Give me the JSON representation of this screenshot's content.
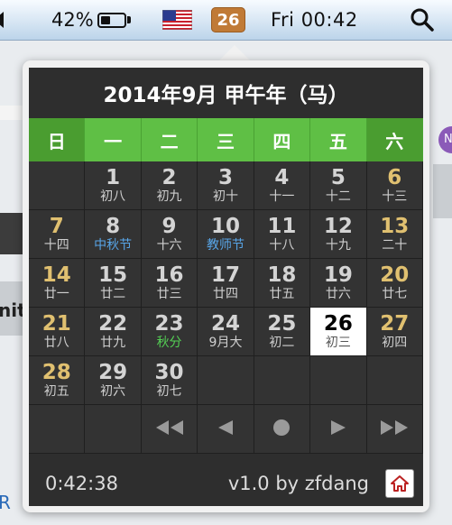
{
  "menubar": {
    "battery_percent": "42%",
    "battery_level": 0.42,
    "date_badge": "26",
    "clock": "Fri 00:42"
  },
  "background": {
    "partial_text": "nit",
    "partial_letter": "R",
    "badge_letter": "N"
  },
  "calendar": {
    "title": "2014年9月 甲午年（马）",
    "weekdays": [
      "日",
      "一",
      "二",
      "三",
      "四",
      "五",
      "六"
    ],
    "days": [
      {
        "d": "",
        "l": ""
      },
      {
        "d": "1",
        "l": "初八"
      },
      {
        "d": "2",
        "l": "初九"
      },
      {
        "d": "3",
        "l": "初十"
      },
      {
        "d": "4",
        "l": "十一"
      },
      {
        "d": "5",
        "l": "十二"
      },
      {
        "d": "6",
        "l": "十三"
      },
      {
        "d": "7",
        "l": "十四"
      },
      {
        "d": "8",
        "l": "中秋节",
        "kind": "fest"
      },
      {
        "d": "9",
        "l": "十六"
      },
      {
        "d": "10",
        "l": "教师节",
        "kind": "fest"
      },
      {
        "d": "11",
        "l": "十八"
      },
      {
        "d": "12",
        "l": "十九"
      },
      {
        "d": "13",
        "l": "二十"
      },
      {
        "d": "14",
        "l": "廿一"
      },
      {
        "d": "15",
        "l": "廿二"
      },
      {
        "d": "16",
        "l": "廿三"
      },
      {
        "d": "17",
        "l": "廿四"
      },
      {
        "d": "18",
        "l": "廿五"
      },
      {
        "d": "19",
        "l": "廿六"
      },
      {
        "d": "20",
        "l": "廿七"
      },
      {
        "d": "21",
        "l": "廿八"
      },
      {
        "d": "22",
        "l": "廿九"
      },
      {
        "d": "23",
        "l": "秋分",
        "kind": "term"
      },
      {
        "d": "24",
        "l": "9月大"
      },
      {
        "d": "25",
        "l": "初二"
      },
      {
        "d": "26",
        "l": "初三",
        "today": true
      },
      {
        "d": "27",
        "l": "初四"
      },
      {
        "d": "28",
        "l": "初五"
      },
      {
        "d": "29",
        "l": "初六"
      },
      {
        "d": "30",
        "l": "初七"
      },
      {
        "d": "",
        "l": ""
      },
      {
        "d": "",
        "l": ""
      },
      {
        "d": "",
        "l": ""
      },
      {
        "d": "",
        "l": ""
      }
    ],
    "nav": [
      "prev-year-icon",
      "prev-month-icon",
      "today-dot-icon",
      "next-month-icon",
      "next-year-icon"
    ],
    "time": "0:42:38",
    "byline": "v1.0 by zfdang"
  }
}
